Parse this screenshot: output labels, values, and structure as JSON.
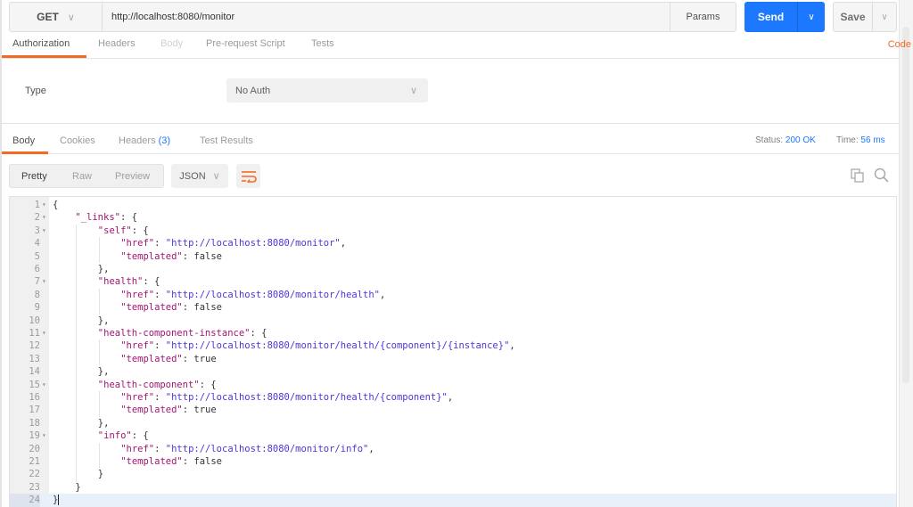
{
  "request": {
    "method": "GET",
    "url": "http://localhost:8080/monitor",
    "params_label": "Params",
    "send_label": "Send",
    "save_label": "Save"
  },
  "request_tabs": [
    {
      "label": "Authorization",
      "state": "active"
    },
    {
      "label": "Headers",
      "state": "normal"
    },
    {
      "label": "Body",
      "state": "disabled"
    },
    {
      "label": "Pre-request Script",
      "state": "normal"
    },
    {
      "label": "Tests",
      "state": "normal"
    }
  ],
  "code_link": "Code",
  "auth": {
    "type_label": "Type",
    "type_value": "No Auth"
  },
  "response_tabs": [
    {
      "label": "Body",
      "state": "active"
    },
    {
      "label": "Cookies",
      "state": "normal"
    },
    {
      "label": "Headers",
      "count": "(3)",
      "state": "normal"
    },
    {
      "label": "Test Results",
      "state": "normal"
    }
  ],
  "status": {
    "label": "Status:",
    "value": "200 OK"
  },
  "time": {
    "label": "Time:",
    "value": "56 ms"
  },
  "view_modes": [
    "Pretty",
    "Raw",
    "Preview"
  ],
  "active_view": "Pretty",
  "format": "JSON",
  "icons": {
    "wrap": "wrap-lines-icon",
    "copy": "copy-icon",
    "search": "search-icon"
  },
  "colors": {
    "accent_orange": "#f26b21",
    "send_blue": "#1c78ff",
    "json_key": "#a31572",
    "json_string": "#4c36d9"
  },
  "code_lines": [
    {
      "n": "1",
      "fold": true,
      "indent": 0,
      "tokens": [
        [
          "p",
          "{"
        ]
      ]
    },
    {
      "n": "2",
      "fold": true,
      "indent": 1,
      "tokens": [
        [
          "k",
          "\"_links\""
        ],
        [
          "p",
          ": {"
        ]
      ]
    },
    {
      "n": "3",
      "fold": true,
      "indent": 2,
      "tokens": [
        [
          "k",
          "\"self\""
        ],
        [
          "p",
          ": {"
        ]
      ]
    },
    {
      "n": "4",
      "fold": false,
      "indent": 3,
      "tokens": [
        [
          "k",
          "\"href\""
        ],
        [
          "p",
          ": "
        ],
        [
          "s",
          "\"http://localhost:8080/monitor\""
        ],
        [
          "p",
          ","
        ]
      ]
    },
    {
      "n": "5",
      "fold": false,
      "indent": 3,
      "tokens": [
        [
          "k",
          "\"templated\""
        ],
        [
          "p",
          ": false"
        ]
      ]
    },
    {
      "n": "6",
      "fold": false,
      "indent": 2,
      "tokens": [
        [
          "p",
          "},"
        ]
      ]
    },
    {
      "n": "7",
      "fold": true,
      "indent": 2,
      "tokens": [
        [
          "k",
          "\"health\""
        ],
        [
          "p",
          ": {"
        ]
      ]
    },
    {
      "n": "8",
      "fold": false,
      "indent": 3,
      "tokens": [
        [
          "k",
          "\"href\""
        ],
        [
          "p",
          ": "
        ],
        [
          "s",
          "\"http://localhost:8080/monitor/health\""
        ],
        [
          "p",
          ","
        ]
      ]
    },
    {
      "n": "9",
      "fold": false,
      "indent": 3,
      "tokens": [
        [
          "k",
          "\"templated\""
        ],
        [
          "p",
          ": false"
        ]
      ]
    },
    {
      "n": "10",
      "fold": false,
      "indent": 2,
      "tokens": [
        [
          "p",
          "},"
        ]
      ]
    },
    {
      "n": "11",
      "fold": true,
      "indent": 2,
      "tokens": [
        [
          "k",
          "\"health-component-instance\""
        ],
        [
          "p",
          ": {"
        ]
      ]
    },
    {
      "n": "12",
      "fold": false,
      "indent": 3,
      "tokens": [
        [
          "k",
          "\"href\""
        ],
        [
          "p",
          ": "
        ],
        [
          "s",
          "\"http://localhost:8080/monitor/health/{component}/{instance}\""
        ],
        [
          "p",
          ","
        ]
      ]
    },
    {
      "n": "13",
      "fold": false,
      "indent": 3,
      "tokens": [
        [
          "k",
          "\"templated\""
        ],
        [
          "p",
          ": true"
        ]
      ]
    },
    {
      "n": "14",
      "fold": false,
      "indent": 2,
      "tokens": [
        [
          "p",
          "},"
        ]
      ]
    },
    {
      "n": "15",
      "fold": true,
      "indent": 2,
      "tokens": [
        [
          "k",
          "\"health-component\""
        ],
        [
          "p",
          ": {"
        ]
      ]
    },
    {
      "n": "16",
      "fold": false,
      "indent": 3,
      "tokens": [
        [
          "k",
          "\"href\""
        ],
        [
          "p",
          ": "
        ],
        [
          "s",
          "\"http://localhost:8080/monitor/health/{component}\""
        ],
        [
          "p",
          ","
        ]
      ]
    },
    {
      "n": "17",
      "fold": false,
      "indent": 3,
      "tokens": [
        [
          "k",
          "\"templated\""
        ],
        [
          "p",
          ": true"
        ]
      ]
    },
    {
      "n": "18",
      "fold": false,
      "indent": 2,
      "tokens": [
        [
          "p",
          "},"
        ]
      ]
    },
    {
      "n": "19",
      "fold": true,
      "indent": 2,
      "tokens": [
        [
          "k",
          "\"info\""
        ],
        [
          "p",
          ": {"
        ]
      ]
    },
    {
      "n": "20",
      "fold": false,
      "indent": 3,
      "tokens": [
        [
          "k",
          "\"href\""
        ],
        [
          "p",
          ": "
        ],
        [
          "s",
          "\"http://localhost:8080/monitor/info\""
        ],
        [
          "p",
          ","
        ]
      ]
    },
    {
      "n": "21",
      "fold": false,
      "indent": 3,
      "tokens": [
        [
          "k",
          "\"templated\""
        ],
        [
          "p",
          ": false"
        ]
      ]
    },
    {
      "n": "22",
      "fold": false,
      "indent": 2,
      "tokens": [
        [
          "p",
          "}"
        ]
      ]
    },
    {
      "n": "23",
      "fold": false,
      "indent": 1,
      "tokens": [
        [
          "p",
          "}"
        ]
      ]
    },
    {
      "n": "24",
      "fold": false,
      "indent": 0,
      "tokens": [
        [
          "p",
          "}"
        ]
      ],
      "current": true
    }
  ]
}
